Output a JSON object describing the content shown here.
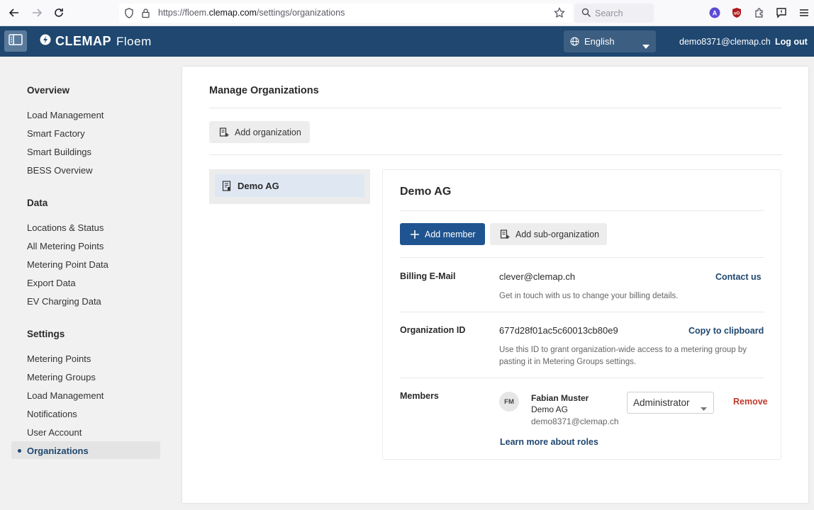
{
  "browser": {
    "url_prefix": "https://floem.",
    "url_domain": "clemap.com",
    "url_path": "/settings/organizations",
    "search_placeholder": "Search"
  },
  "header": {
    "brand_name": "CLEMAP",
    "brand_product": "Floem",
    "language": "English",
    "user_email": "demo8371@clemap.ch",
    "logout_label": "Log out"
  },
  "sidebar": {
    "overview_heading": "Overview",
    "overview_items": [
      "Load Management",
      "Smart Factory",
      "Smart Buildings",
      "BESS Overview"
    ],
    "data_heading": "Data",
    "data_items": [
      "Locations & Status",
      "All Metering Points",
      "Metering Point Data",
      "Export Data",
      "EV Charging Data"
    ],
    "settings_heading": "Settings",
    "settings_items": [
      "Metering Points",
      "Metering Groups",
      "Load Management",
      "Notifications",
      "User Account"
    ],
    "active_item": "Organizations"
  },
  "main": {
    "title": "Manage Organizations",
    "add_org_label": "Add organization",
    "org_list": [
      {
        "name": "Demo AG"
      }
    ],
    "detail": {
      "title": "Demo AG",
      "add_member_label": "Add member",
      "add_sub_org_label": "Add sub-organization",
      "billing_label": "Billing E-Mail",
      "billing_value": "clever@clemap.ch",
      "billing_action": "Contact us",
      "billing_desc": "Get in touch with us to change your billing details.",
      "org_id_label": "Organization ID",
      "org_id_value": "677d28f01ac5c60013cb80e9",
      "org_id_action": "Copy to clipboard",
      "org_id_desc_1": "Use this ID to grant organization-wide access to a metering group by",
      "org_id_desc_2": "pasting it in Metering Groups settings.",
      "members_label": "Members",
      "member": {
        "initials": "FM",
        "name": "Fabian Muster",
        "org": "Demo AG",
        "email": "demo8371@clemap.ch",
        "role": "Administrator",
        "remove_label": "Remove"
      },
      "roles_link": "Learn more about roles"
    }
  },
  "colors": {
    "header_bg": "#1f4770",
    "primary_button": "#1f5490",
    "remove_red": "#c0392b"
  }
}
